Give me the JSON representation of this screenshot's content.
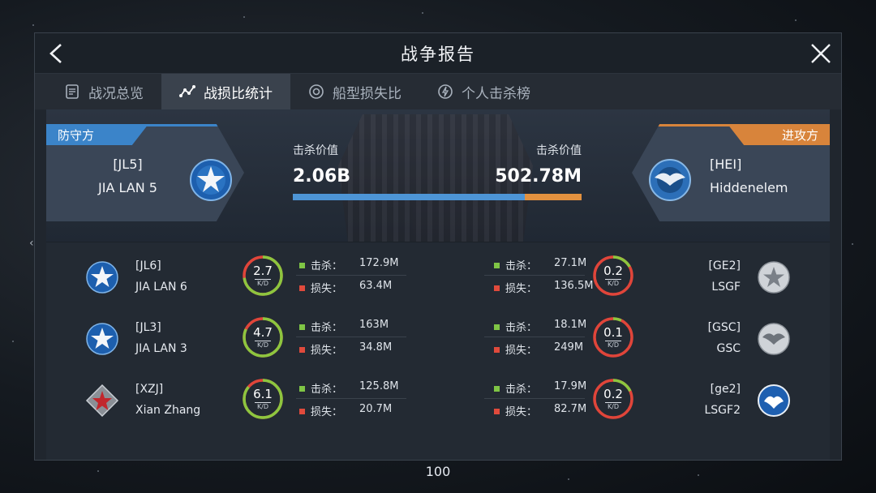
{
  "window": {
    "title": "战争报告"
  },
  "tabs": [
    {
      "label": "战况总览",
      "icon": "document-icon",
      "active": false
    },
    {
      "label": "战损比统计",
      "icon": "trend-icon",
      "active": true
    },
    {
      "label": "船型损失比",
      "icon": "target-icon",
      "active": false
    },
    {
      "label": "个人击杀榜",
      "icon": "lightning-icon",
      "active": false
    }
  ],
  "versus": {
    "defender": {
      "role": "防守方",
      "tag": "[JL5]",
      "name": "JIA LAN 5",
      "kill_label": "击杀价值",
      "kill_value": "2.06B",
      "color": "#3b84c9"
    },
    "attacker": {
      "role": "进攻方",
      "tag": "[HEI]",
      "name": "Hiddenelem",
      "kill_label": "击杀价值",
      "kill_value": "502.78M",
      "color": "#d8843b"
    },
    "defender_share": 0.804
  },
  "labels": {
    "kill": "击杀：",
    "loss": "损失：",
    "kd_unit": "K/D"
  },
  "rows": [
    {
      "left": {
        "tag": "[JL6]",
        "name": "JIA LAN 6",
        "kd": "2.7",
        "kd_ratio": 0.73,
        "kill": "172.9M",
        "loss": "63.4M",
        "emblem": "star-shield-icon"
      },
      "right": {
        "tag": "[GE2]",
        "name": "LSGF",
        "kd": "0.2",
        "kd_ratio": 0.17,
        "kill": "27.1M",
        "loss": "136.5M",
        "emblem": "grey-star-icon"
      }
    },
    {
      "left": {
        "tag": "[JL3]",
        "name": "JIA LAN 3",
        "kd": "4.7",
        "kd_ratio": 0.82,
        "kill": "163M",
        "loss": "34.8M",
        "emblem": "star-shield-icon"
      },
      "right": {
        "tag": "[GSC]",
        "name": "GSC",
        "kd": "0.1",
        "kd_ratio": 0.07,
        "kill": "18.1M",
        "loss": "249M",
        "emblem": "grey-wings-icon"
      }
    },
    {
      "left": {
        "tag": "[XZJ]",
        "name": "Xian Zhang",
        "kd": "6.1",
        "kd_ratio": 0.86,
        "kill": "125.8M",
        "loss": "20.7M",
        "emblem": "red-star-icon"
      },
      "right": {
        "tag": "[ge2]",
        "name": "LSGF2",
        "kd": "0.2",
        "kd_ratio": 0.18,
        "kill": "17.9M",
        "loss": "82.7M",
        "emblem": "blue-wings-icon"
      }
    }
  ],
  "footer": {
    "number": "100"
  },
  "colors": {
    "kill": "#7fc545",
    "loss": "#e04a3c",
    "ring_good": "#8dc63f",
    "ring_bad": "#e0453a"
  }
}
